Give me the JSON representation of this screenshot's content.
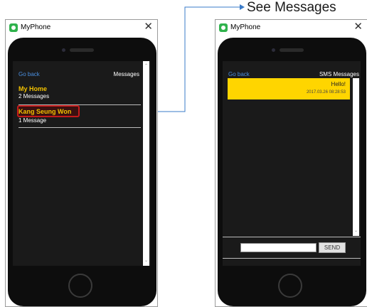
{
  "callout": {
    "label": "See Messages"
  },
  "colors": {
    "link": "#4a8fe0",
    "accent_yellow": "#f2c100",
    "bubble": "#ffd500",
    "highlight": "#c41a1a",
    "arrow": "#3a7bc8"
  },
  "left_window": {
    "title": "MyPhone",
    "close_glyph": "✕",
    "back_label": "Go back",
    "header": "Messages",
    "conversations": [
      {
        "name": "My Home",
        "count": "2 Messages"
      },
      {
        "name": "Kang Seung Won",
        "count": "1 Message"
      }
    ]
  },
  "right_window": {
    "title": "MyPhone",
    "close_glyph": "✕",
    "back_label": "Go back",
    "header": "SMS Messages",
    "messages": [
      {
        "text": "Hello!",
        "time": "2017.03.26 08:28:53"
      }
    ],
    "input_value": "",
    "send_label": "SEND"
  },
  "icons": {
    "app": "phone-app-icon",
    "close": "close-icon",
    "scroll_up": "scroll-up-arrow-icon",
    "scroll_down": "scroll-down-arrow-icon",
    "home": "home-button-icon"
  }
}
